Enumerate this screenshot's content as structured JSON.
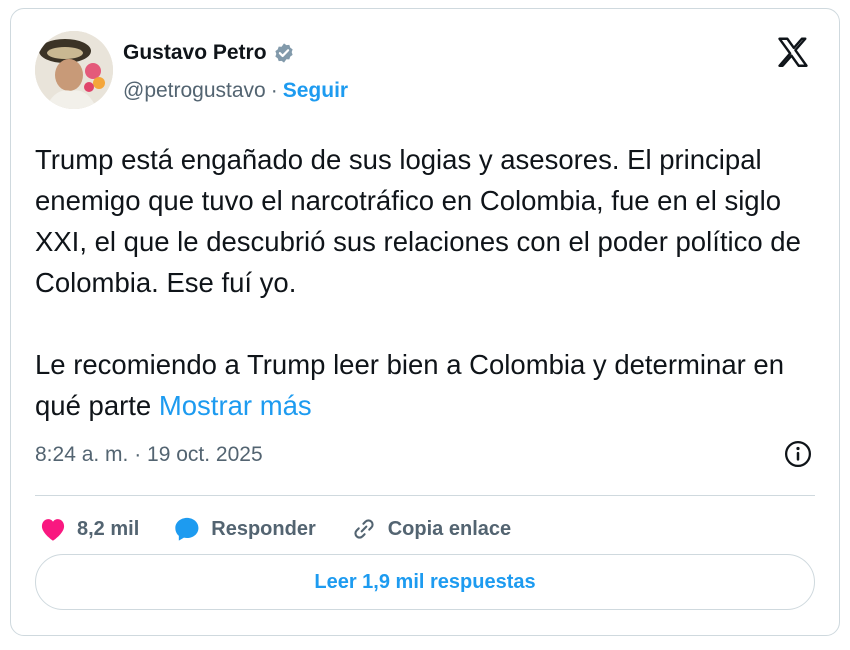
{
  "author": {
    "name": "Gustavo Petro",
    "handle": "@petrogustavo",
    "separator": "·",
    "follow_label": "Seguir"
  },
  "tweet": {
    "paragraph1": "Trump está engañado de sus logias y asesores. El principal enemigo que tuvo el narcotráfico en Colombia, fue en el siglo XXI, el que le descubrió sus relaciones con el poder político de Colombia. Ese fuí yo.",
    "paragraph2": "Le recomiendo a Trump leer bien a Colombia y determinar en qué parte ",
    "show_more": "Mostrar más",
    "timestamp": "8:24 a. m. · 19 oct. 2025"
  },
  "actions": {
    "likes": "8,2 mil",
    "reply_label": "Responder",
    "copy_label": "Copia enlace"
  },
  "read_replies_label": "Leer 1,9 mil respuestas",
  "colors": {
    "accent": "#1d9bf0",
    "like": "#f91880",
    "muted": "#536471",
    "border": "#cfd9de"
  }
}
